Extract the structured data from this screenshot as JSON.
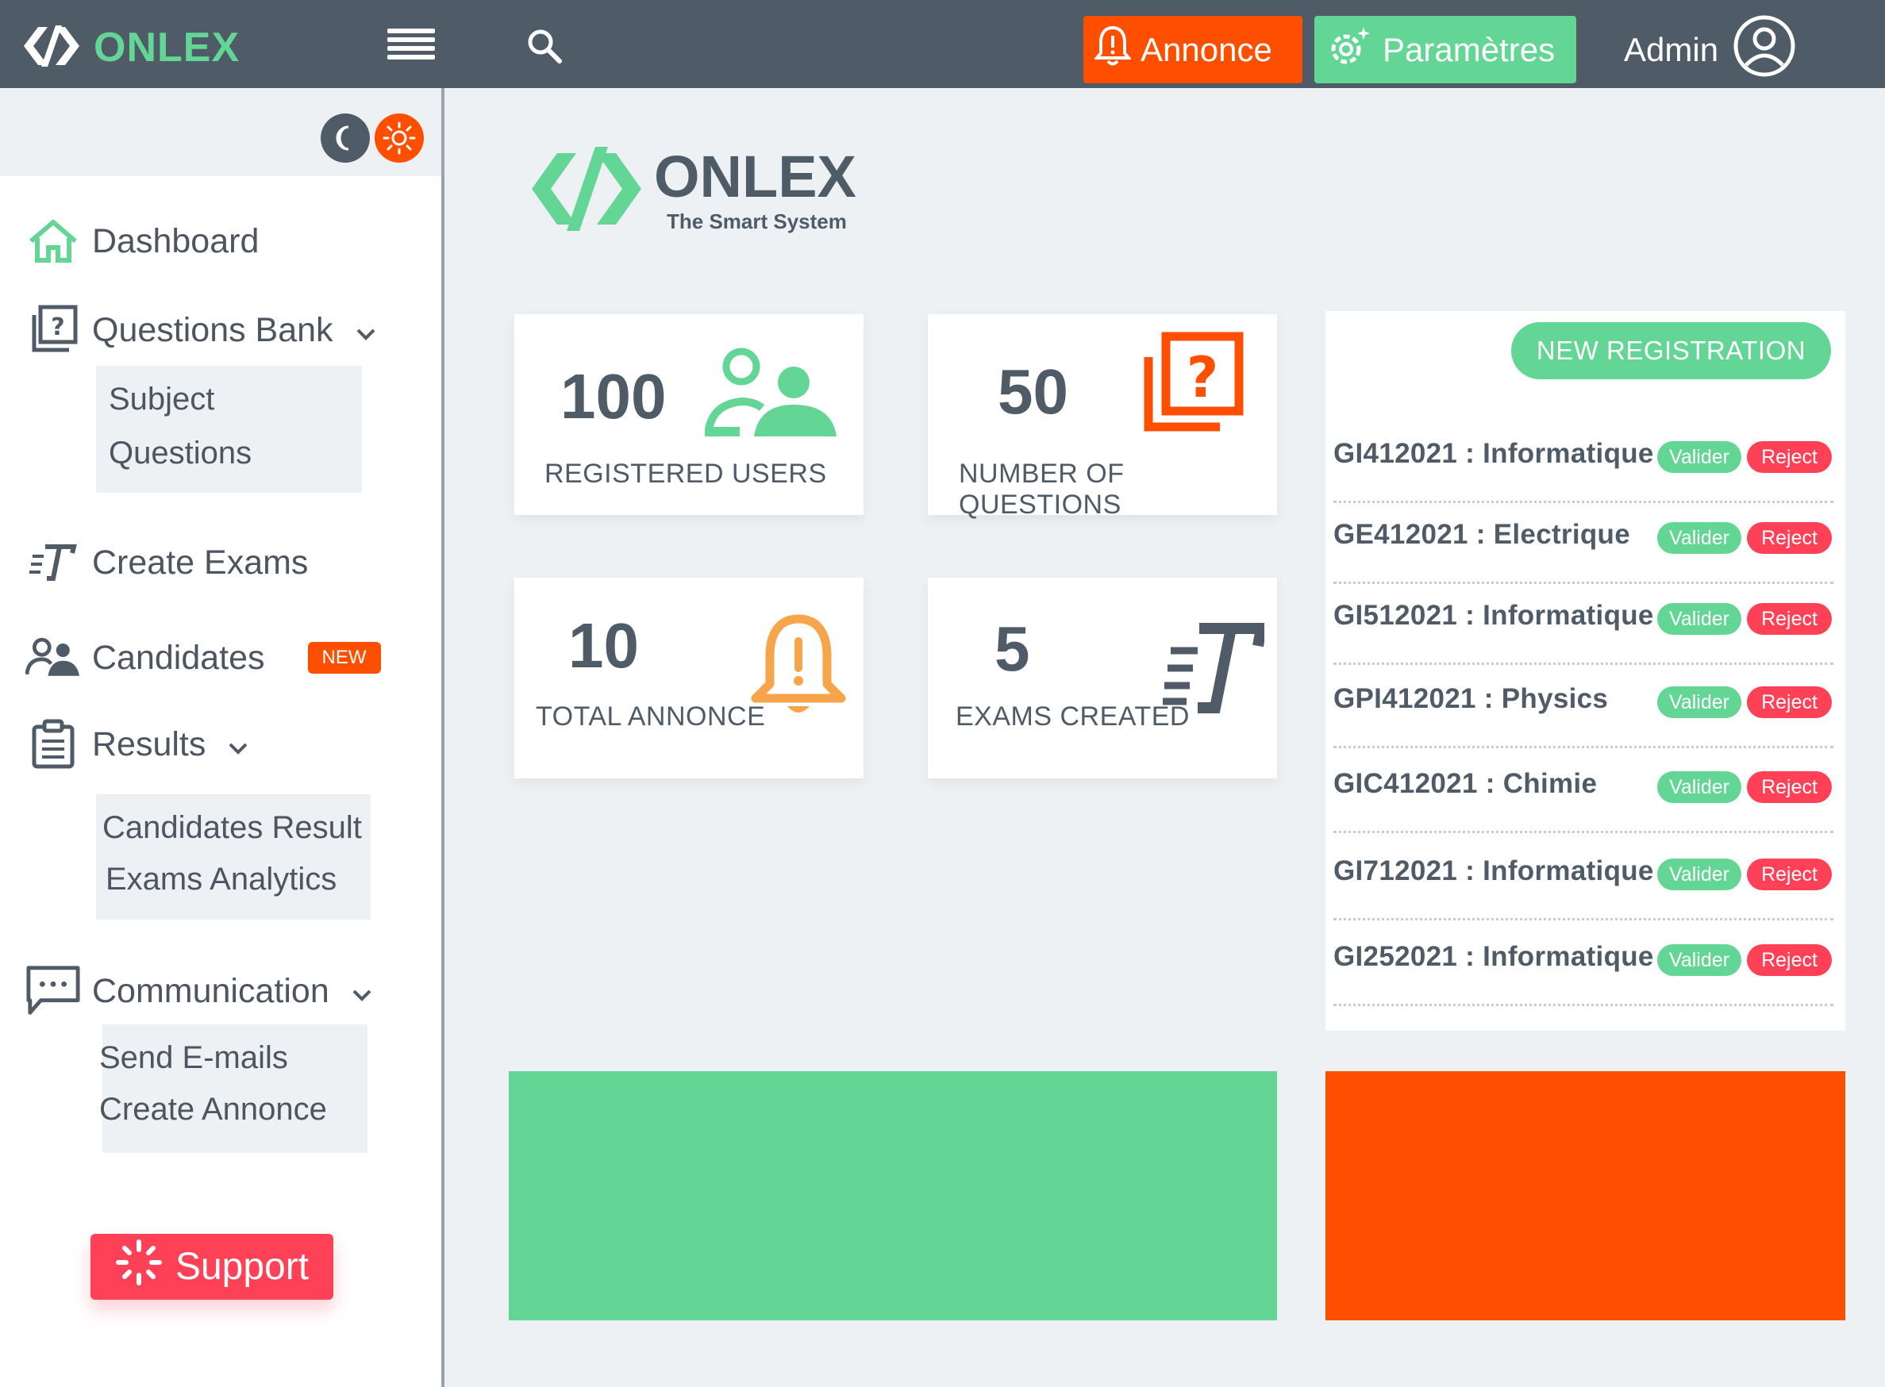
{
  "brand": {
    "name": "ONLEX",
    "tagline": "The Smart System"
  },
  "topbar": {
    "annonce_label": "Annonce",
    "params_label": "Paramètres",
    "admin_label": "Admin"
  },
  "sidebar": {
    "dashboard": "Dashboard",
    "questions_bank": "Questions Bank",
    "questions_bank_sub": [
      "Subject",
      "Questions"
    ],
    "create_exams": "Create Exams",
    "candidates": "Candidates",
    "candidates_badge": "NEW",
    "results": "Results",
    "results_sub": [
      "Candidates Result",
      "Exams Analytics"
    ],
    "communication": "Communication",
    "communication_sub": [
      "Send E-mails",
      "Create Annonce"
    ],
    "support": "Support"
  },
  "stats": [
    {
      "value": "100",
      "label": "REGISTERED USERS",
      "icon": "users-icon"
    },
    {
      "value": "50",
      "label": "NUMBER OF QUESTIONS",
      "icon": "question-bank-icon"
    },
    {
      "value": "10",
      "label": "TOTAL ANNONCE",
      "icon": "bell-alert-icon"
    },
    {
      "value": "5",
      "label": "EXAMS CREATED",
      "icon": "exam-icon"
    }
  ],
  "registrations": {
    "new_label": "NEW REGISTRATION",
    "valider_label": "Valider",
    "reject_label": "Reject",
    "items": [
      "GI412021 : Informatique",
      "GE412021 : Electrique",
      "GI512021 : Informatique",
      "GPI412021 : Physics",
      "GIC412021 : Chimie",
      "GI712021 : Informatique",
      "GI252021 : Informatique"
    ]
  },
  "colors": {
    "green": "#63d594",
    "orange": "#fe4e00",
    "red": "#fe4157",
    "slate": "#4f5b66",
    "bell": "#f7a54a"
  }
}
